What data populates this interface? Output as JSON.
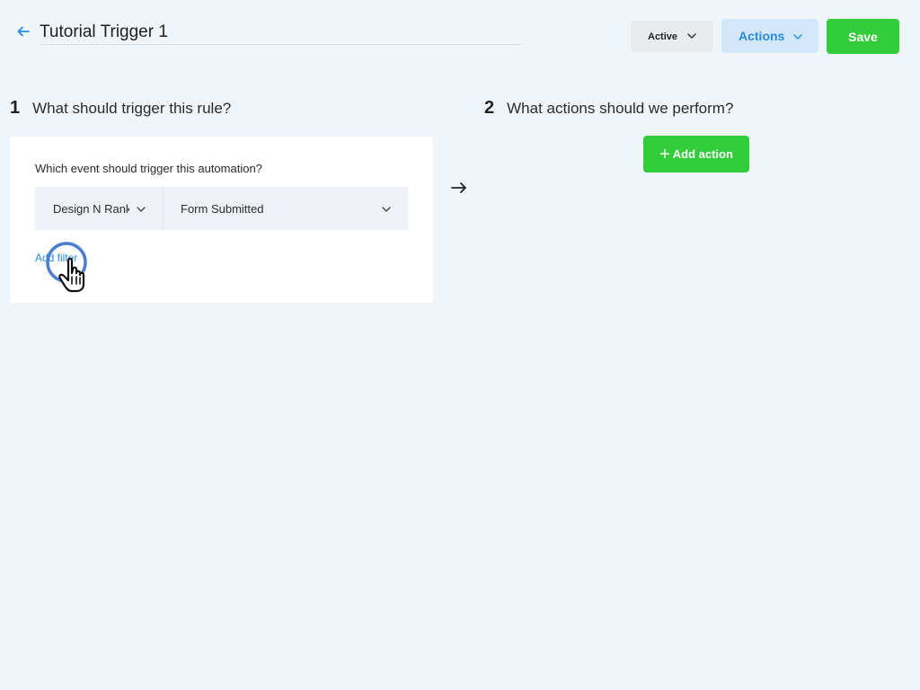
{
  "header": {
    "title_value": "Tutorial Trigger 1",
    "status": {
      "selected": "Active"
    },
    "actions_label": "Actions",
    "save_label": "Save"
  },
  "step1": {
    "number": "1",
    "heading": "What should trigger this rule?",
    "question": "Which event should trigger this automation?",
    "source_value": "Design N Rank",
    "event_value": "Form Submitted",
    "add_filter_label": "Add filter"
  },
  "step2": {
    "number": "2",
    "heading": "What actions should we perform?",
    "add_action_label": "Add action"
  },
  "icons": {
    "back": "arrow-left-icon",
    "chevron": "chevron-down-icon",
    "flow": "arrow-right-icon",
    "plus": "plus-icon",
    "cursor": "hand-pointer-cursor-icon"
  },
  "colors": {
    "background": "#f0f5f9",
    "accent_blue": "#2a8be6",
    "primary_green": "#33cc3a",
    "actions_bg": "#d3e7fb",
    "status_bg": "#e9ecef"
  }
}
